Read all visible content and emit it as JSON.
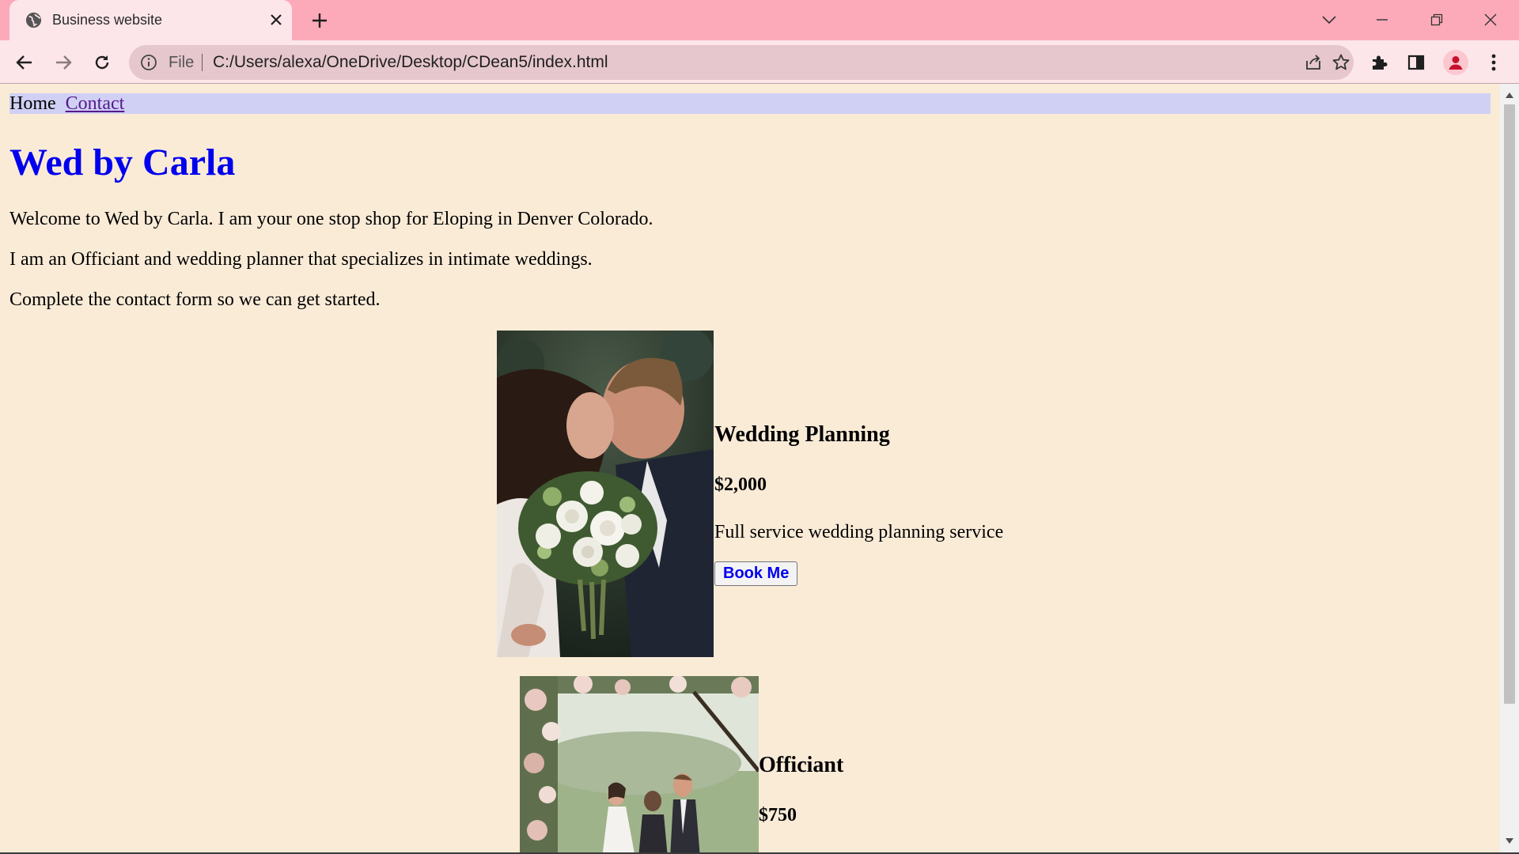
{
  "browser": {
    "tab_title": "Business website",
    "address_scheme": "File",
    "url": "C:/Users/alexa/OneDrive/Desktop/CDean5/index.html"
  },
  "site": {
    "nav": {
      "home": "Home",
      "contact": "Contact"
    },
    "title": "Wed by Carla",
    "intro": [
      "Welcome to Wed by Carla. I am your one stop shop for Eloping in Denver Colorado.",
      "I am an Officiant and wedding planner that specializes in intimate weddings.",
      "Complete the contact form so we can get started."
    ],
    "services": [
      {
        "title": "Wedding Planning",
        "price": "$2,000",
        "description": "Full service wedding planning service",
        "button": "Book Me"
      },
      {
        "title": "Officiant",
        "price": "$750"
      }
    ]
  },
  "colors": {
    "tabstrip": "#fcaab9",
    "toolbar": "#fde6ea",
    "page_background": "#faebd7",
    "nav_background": "#d0d0f5",
    "title": "#0000ee",
    "visited_link": "#551a8b",
    "avatar": "#c8102e"
  }
}
